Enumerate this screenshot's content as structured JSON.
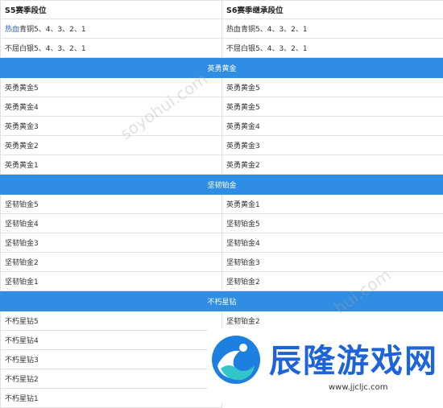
{
  "table": {
    "header": [
      "S5赛季段位",
      "S6赛季继承段位"
    ],
    "top_rows": [
      {
        "prefix": "热血",
        "rest": "青铜5、4、3、2、1",
        "right": "热血青铜5、4、3、2、1"
      },
      {
        "left": "不屈白银5、4、3、2、1",
        "right": "不屈白银5、4、3、2、1"
      }
    ],
    "sections": [
      {
        "title": "英勇黄金",
        "rows": [
          [
            "英勇黄金5",
            "英勇黄金5"
          ],
          [
            "英勇黄金4",
            "英勇黄金5"
          ],
          [
            "英勇黄金3",
            "英勇黄金4"
          ],
          [
            "英勇黄金2",
            "英勇黄金3"
          ],
          [
            "英勇黄金1",
            "英勇黄金2"
          ]
        ]
      },
      {
        "title": "坚韧铂金",
        "rows": [
          [
            "坚韧铂金5",
            "英勇黄金1"
          ],
          [
            "坚韧铂金4",
            "坚韧铂金5"
          ],
          [
            "坚韧铂金3",
            "坚韧铂金4"
          ],
          [
            "坚韧铂金2",
            "坚韧铂金3"
          ],
          [
            "坚韧铂金1",
            "坚韧铂金2"
          ]
        ]
      },
      {
        "title": "不朽星钻",
        "rows": [
          [
            "不朽星钻5",
            "坚韧铂金2"
          ],
          [
            "不朽星钻4",
            ""
          ],
          [
            "不朽星钻3",
            ""
          ],
          [
            "不朽星钻2",
            ""
          ],
          [
            "不朽星钻1",
            ""
          ]
        ]
      }
    ]
  },
  "watermark": {
    "text": "soyohui.com",
    "text2": "hui.com"
  },
  "logo": {
    "text": "辰隆游戏网",
    "url": "www.jjcljc.com"
  },
  "colors": {
    "section_bg": "#2f8de4",
    "logo_blue": "#1d64d9"
  }
}
